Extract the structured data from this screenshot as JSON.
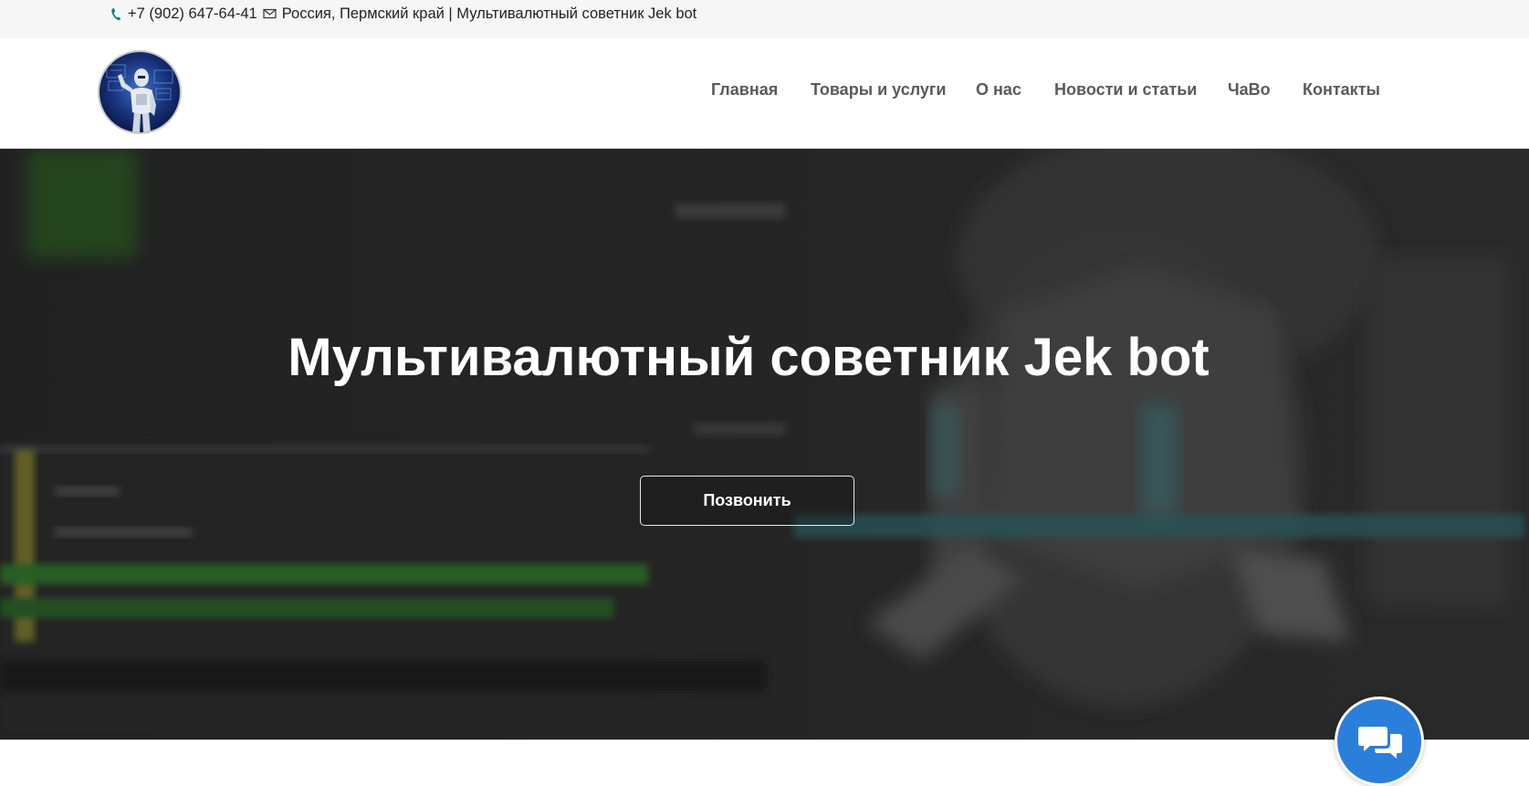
{
  "topbar": {
    "phone": "+7 (902) 647-64-41",
    "location_text": "Россия, Пермский край | Мультивалютный советник Jek bot",
    "phone_icon": "phone-icon",
    "mail_icon": "mail-icon"
  },
  "header": {
    "logo_icon": "robot-logo",
    "nav": [
      {
        "label": "Главная"
      },
      {
        "label": "Товары и услуги"
      },
      {
        "label": "О нас"
      },
      {
        "label": "Новости и статьи"
      },
      {
        "label": "ЧаВо"
      },
      {
        "label": "Контакты"
      }
    ]
  },
  "hero": {
    "title": "Мультивалютный советник Jek bot",
    "button_label": "Позвонить"
  },
  "chat": {
    "icon": "chat-bubbles-icon"
  },
  "colors": {
    "topbar_bg": "#f6f6f6",
    "nav_text": "#5a5a5a",
    "hero_overlay": "#2c2c2c",
    "chat_button": "#2a7fdb",
    "phone_icon": "#17837e"
  }
}
